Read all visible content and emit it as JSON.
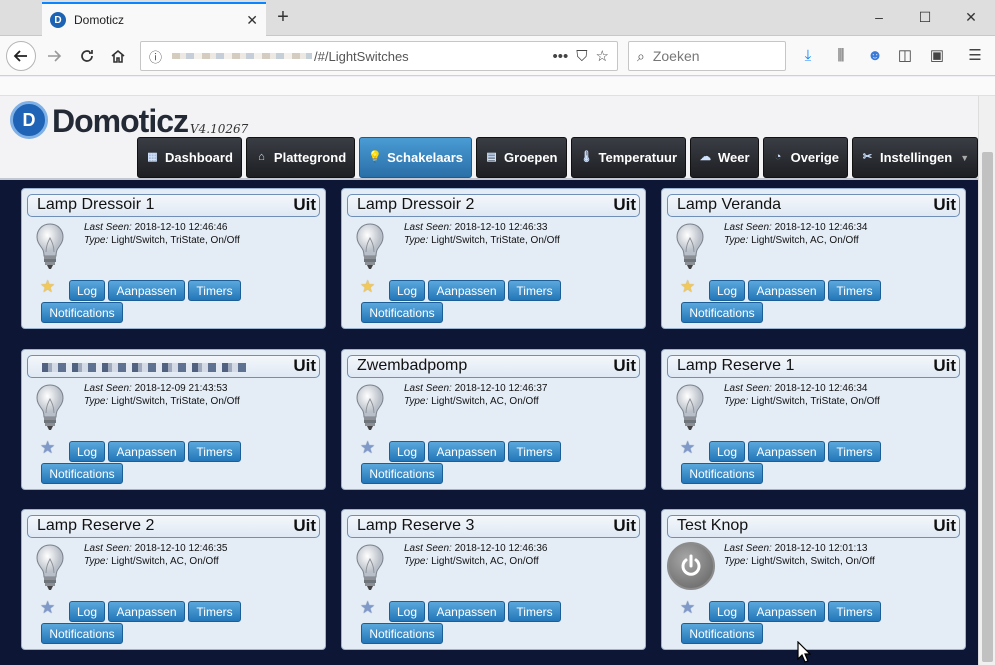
{
  "browser": {
    "tab_title": "Domoticz",
    "favicon_letter": "D",
    "new_tab": "+",
    "url_path": "/#/LightSwitches",
    "search_placeholder": "Zoeken",
    "window_controls": [
      "–",
      "☐",
      "✕"
    ]
  },
  "app": {
    "logo_letter": "D",
    "name": "Domoticz",
    "version": "V4.10267"
  },
  "menu": [
    {
      "label": "Dashboard",
      "icon": "dashboard-icon",
      "active": false
    },
    {
      "label": "Plattegrond",
      "icon": "floorplan-icon",
      "active": false
    },
    {
      "label": "Schakelaars",
      "icon": "lightbulb-icon",
      "active": true
    },
    {
      "label": "Groepen",
      "icon": "scenes-icon",
      "active": false
    },
    {
      "label": "Temperatuur",
      "icon": "thermometer-icon",
      "active": false
    },
    {
      "label": "Weer",
      "icon": "weather-icon",
      "active": false
    },
    {
      "label": "Overige",
      "icon": "utility-icon",
      "active": false
    },
    {
      "label": "Instellingen",
      "icon": "settings-icon",
      "active": false
    }
  ],
  "labels": {
    "last_seen": "Last Seen:",
    "type": "Type:",
    "log": "Log",
    "edit": "Aanpassen",
    "timers": "Timers",
    "notifications": "Notifications"
  },
  "devices": [
    {
      "name": "Lamp Dressoir 1",
      "state": "Uit",
      "last_seen": "2018-12-10 12:46:46",
      "type": "Light/Switch, TriState, On/Off",
      "favorite": true,
      "icon": "lightbulb-icon"
    },
    {
      "name": "Lamp Dressoir 2",
      "state": "Uit",
      "last_seen": "2018-12-10 12:46:33",
      "type": "Light/Switch, TriState, On/Off",
      "favorite": true,
      "icon": "lightbulb-icon"
    },
    {
      "name": "Lamp Veranda",
      "state": "Uit",
      "last_seen": "2018-12-10 12:46:34",
      "type": "Light/Switch, AC, On/Off",
      "favorite": true,
      "icon": "lightbulb-icon"
    },
    {
      "name": "",
      "state": "Uit",
      "last_seen": "2018-12-09 21:43:53",
      "type": "Light/Switch, TriState, On/Off",
      "favorite": false,
      "icon": "lightbulb-icon",
      "name_redacted": true
    },
    {
      "name": "Zwembadpomp",
      "state": "Uit",
      "last_seen": "2018-12-10 12:46:37",
      "type": "Light/Switch, AC, On/Off",
      "favorite": false,
      "icon": "lightbulb-icon"
    },
    {
      "name": "Lamp Reserve 1",
      "state": "Uit",
      "last_seen": "2018-12-10 12:46:34",
      "type": "Light/Switch, TriState, On/Off",
      "favorite": false,
      "icon": "lightbulb-icon"
    },
    {
      "name": "Lamp Reserve 2",
      "state": "Uit",
      "last_seen": "2018-12-10 12:46:35",
      "type": "Light/Switch, AC, On/Off",
      "favorite": false,
      "icon": "lightbulb-icon"
    },
    {
      "name": "Lamp Reserve 3",
      "state": "Uit",
      "last_seen": "2018-12-10 12:46:36",
      "type": "Light/Switch, AC, On/Off",
      "favorite": false,
      "icon": "lightbulb-icon"
    },
    {
      "name": "Test Knop",
      "state": "Uit",
      "last_seen": "2018-12-10 12:01:13",
      "type": "Light/Switch, Switch, On/Off",
      "favorite": false,
      "icon": "power-icon"
    }
  ],
  "colors": {
    "page_bg": "#0d1635",
    "active_menu": "#3a86c4",
    "button": "#2a7fbe",
    "card_bg": "#e4ecf5"
  }
}
